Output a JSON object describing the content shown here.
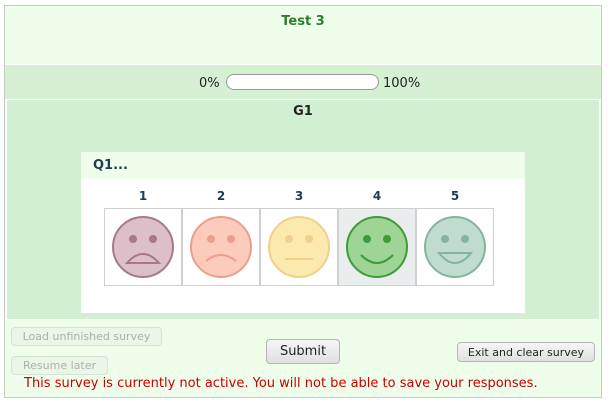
{
  "survey": {
    "title": "Test 3"
  },
  "progress": {
    "left_label": "0%",
    "right_label": "100%",
    "value_fraction": 0.0
  },
  "group": {
    "title": "G1"
  },
  "question": {
    "title": "Q1...",
    "options": [
      {
        "label": "1",
        "face": "very-sad-face-icon",
        "fill": "#dcbfc8",
        "stroke": "#a87888",
        "selected": false
      },
      {
        "label": "2",
        "face": "sad-face-icon",
        "fill": "#fccbbb",
        "stroke": "#ea9f8d",
        "selected": false
      },
      {
        "label": "3",
        "face": "neutral-face-icon",
        "fill": "#fbe9ae",
        "stroke": "#efd08c",
        "selected": false
      },
      {
        "label": "4",
        "face": "happy-face-icon",
        "fill": "#9ed494",
        "stroke": "#3d9b3a",
        "selected": true
      },
      {
        "label": "5",
        "face": "very-happy-face-icon",
        "fill": "#bfdcce",
        "stroke": "#86b39f",
        "selected": false
      }
    ]
  },
  "buttons": {
    "load_unfinished": "Load unfinished survey",
    "resume_later": "Resume later",
    "submit": "Submit",
    "exit_clear": "Exit and clear survey"
  },
  "warning": "This survey is currently not active. You will not be able to save your responses."
}
